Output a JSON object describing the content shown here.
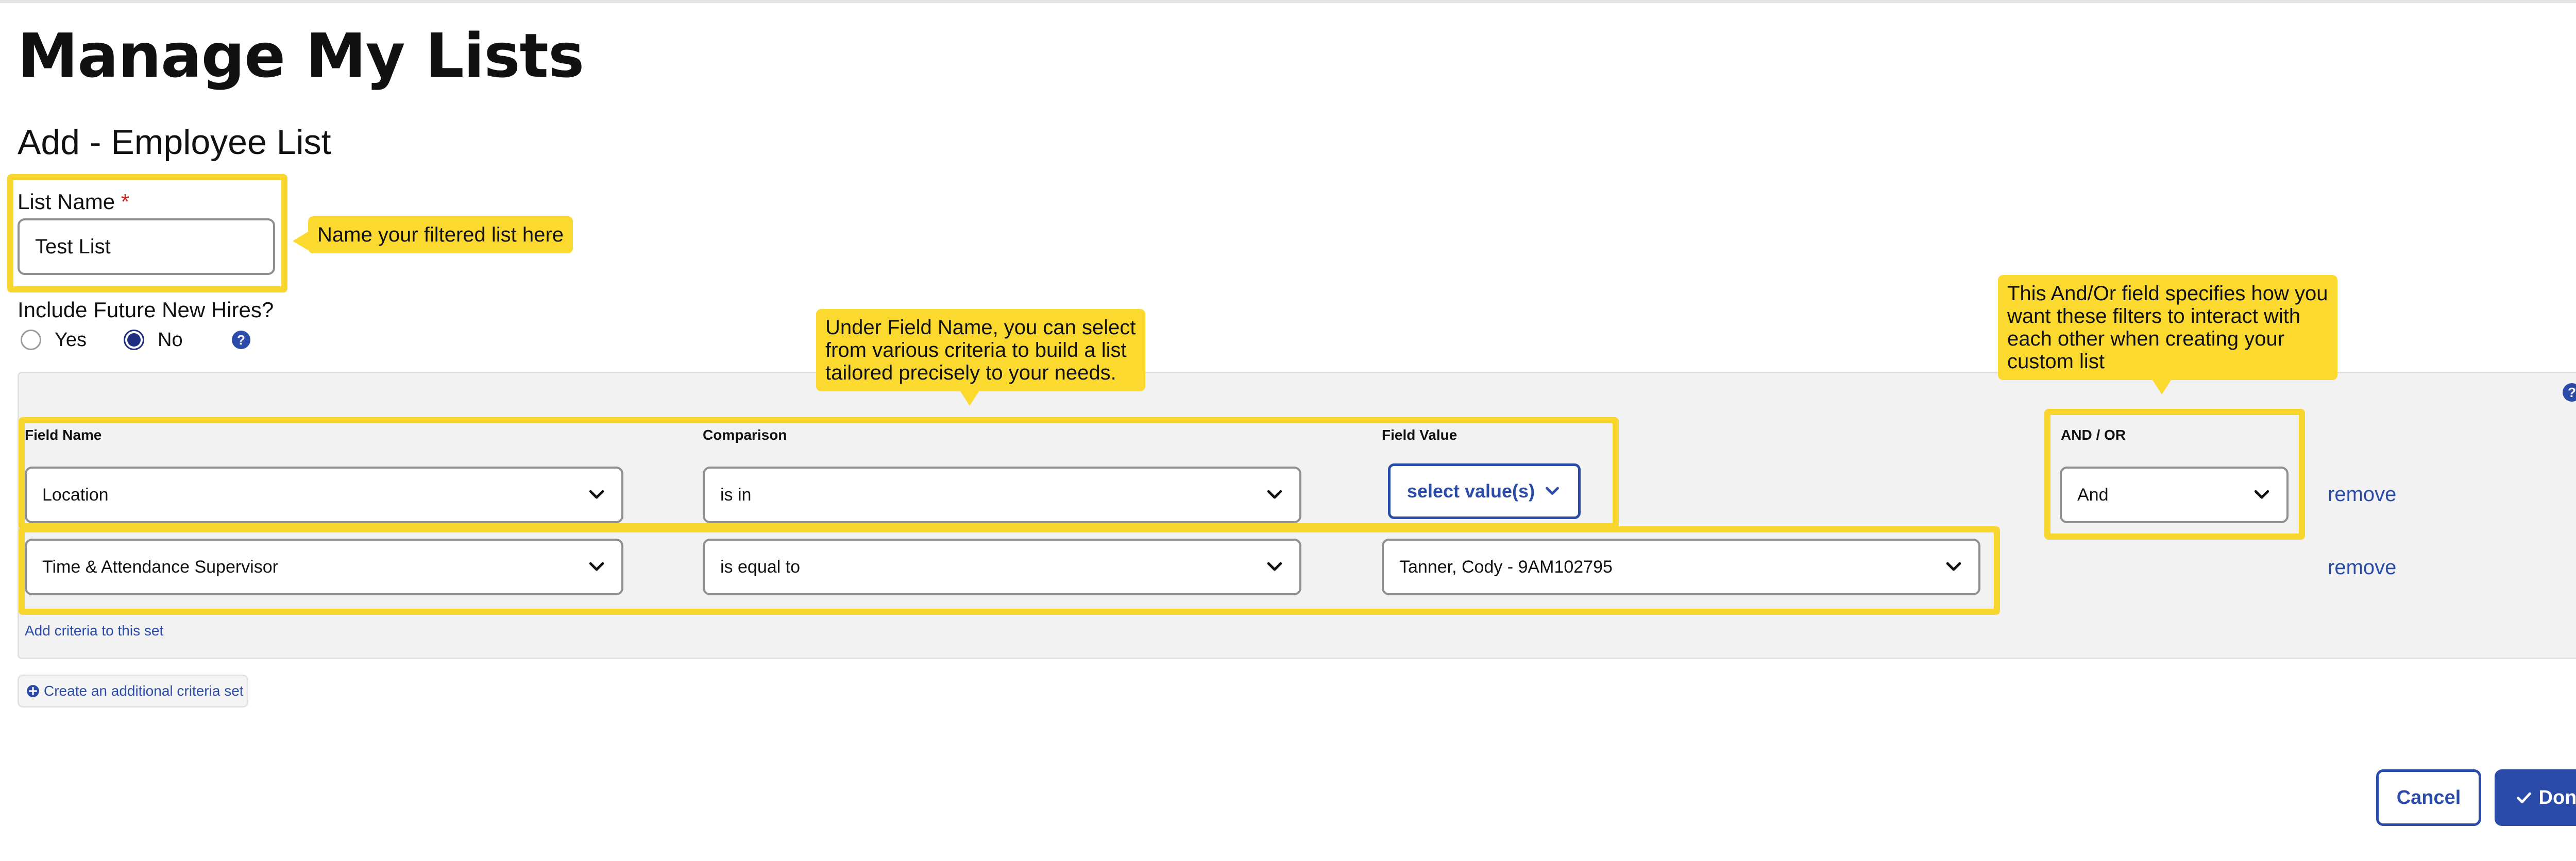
{
  "page": {
    "title": "Manage My Lists",
    "subtitle": "Add - Employee List"
  },
  "list_name": {
    "label": "List Name",
    "required_mark": "*",
    "value": "Test List"
  },
  "future_hires": {
    "label": "Include Future New Hires?",
    "options": [
      {
        "label": "Yes",
        "selected": false
      },
      {
        "label": "No",
        "selected": true
      }
    ],
    "help_glyph": "?"
  },
  "criteria": {
    "help_glyph": "?",
    "columns": {
      "field_name": "Field Name",
      "comparison": "Comparison",
      "field_value": "Field Value",
      "and_or": "AND / OR"
    },
    "rows": [
      {
        "field_name": "Location",
        "comparison": "is in",
        "field_value_button": "select value(s)",
        "and_or": "And",
        "remove": "remove"
      },
      {
        "field_name": "Time & Attendance Supervisor",
        "comparison": "is equal to",
        "field_value": "Tanner, Cody - 9AM102795",
        "remove": "remove"
      }
    ],
    "add_criteria": "Add criteria to this set"
  },
  "create_set": {
    "icon": "plus-circle-icon",
    "label": "Create an additional criteria set"
  },
  "actions": {
    "cancel": "Cancel",
    "done": "Done",
    "done_icon": "check-icon"
  },
  "tooltips": {
    "name": [
      "Name your filtered list here"
    ],
    "field_name": [
      "Under Field Name, you can select",
      "from various criteria to build a list",
      "tailored precisely to your needs."
    ],
    "and_or": [
      "This And/Or field specifies how you",
      "want these filters to interact with",
      "each other when creating your",
      "custom list"
    ]
  },
  "colors": {
    "accent": "#2b4ba8",
    "highlight": "#f9d62e",
    "required": "#cc1f1f",
    "panel_bg": "#f2f2f2"
  }
}
